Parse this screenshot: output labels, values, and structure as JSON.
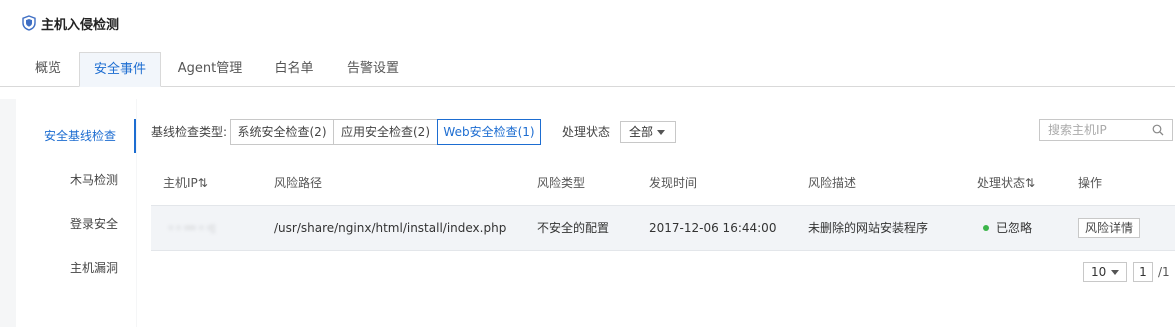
{
  "header": {
    "title": "主机入侵检测",
    "icon": "shield-icon"
  },
  "tabs": [
    {
      "label": "概览",
      "active": false
    },
    {
      "label": "安全事件",
      "active": true
    },
    {
      "label": "Agent管理",
      "active": false
    },
    {
      "label": "白名单",
      "active": false
    },
    {
      "label": "告警设置",
      "active": false
    }
  ],
  "leftnav": [
    {
      "label": "安全基线检查",
      "active": true
    },
    {
      "label": "木马检测",
      "active": false
    },
    {
      "label": "登录安全",
      "active": false
    },
    {
      "label": "主机漏洞",
      "active": false
    }
  ],
  "filter": {
    "type_label": "基线检查类型:",
    "segments": [
      {
        "label": "系统安全检查(2)",
        "active": false
      },
      {
        "label": "应用安全检查(2)",
        "active": false
      },
      {
        "label": "Web安全检查(1)",
        "active": true
      }
    ],
    "status_label": "处理状态",
    "status_value": "全部",
    "search_placeholder": "搜索主机IP"
  },
  "table": {
    "headers": [
      "主机IP⇅",
      "风险路径",
      "风险类型",
      "发现时间",
      "风险描述",
      "处理状态⇅",
      "操作"
    ],
    "rows": [
      {
        "ip": "· · ··· · ·:",
        "path": "/usr/share/nginx/html/install/index.php",
        "risk_type": "不安全的配置",
        "time": "2017-12-06 16:44:00",
        "desc": "未删除的网站安装程序",
        "status": "已忽略",
        "action": "风险详情"
      }
    ]
  },
  "pager": {
    "page_size": "10",
    "current": "1",
    "total": "/1"
  },
  "colors": {
    "accent": "#1d6dd1",
    "status_ok": "#3cb54a"
  }
}
